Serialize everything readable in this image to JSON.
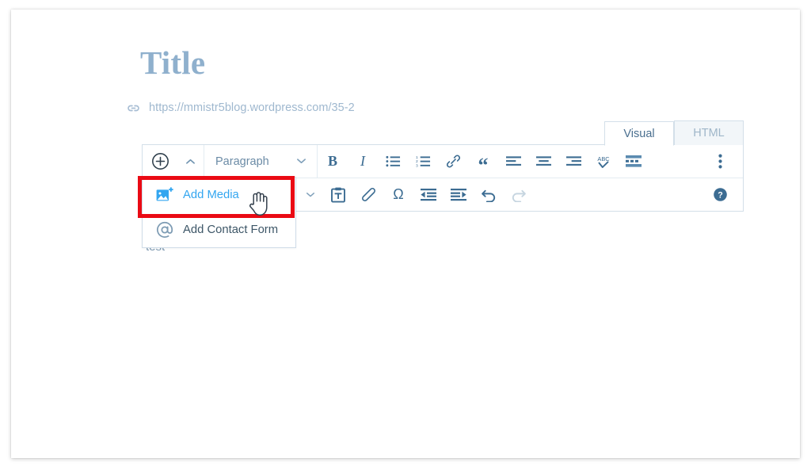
{
  "editor": {
    "title": "Title",
    "permalink": {
      "icon": "link-icon",
      "url": "https://mmistr5blog.wordpress.com/35-2"
    },
    "body_text": "test"
  },
  "mode_tabs": [
    {
      "label": "Visual",
      "active": true
    },
    {
      "label": "HTML",
      "active": false
    }
  ],
  "toolbar": {
    "insert_button_label": "+",
    "collapse_caret_label": "⌃",
    "format_select": {
      "value": "Paragraph",
      "caret": "⌄"
    },
    "row1": [
      {
        "name": "bold-icon",
        "label": "B"
      },
      {
        "name": "italic-icon",
        "label": "I"
      },
      {
        "name": "bulleted-list-icon",
        "label": ""
      },
      {
        "name": "numbered-list-icon",
        "label": ""
      },
      {
        "name": "link-icon",
        "label": ""
      },
      {
        "name": "blockquote-icon",
        "label": "“"
      },
      {
        "name": "align-left-icon",
        "label": ""
      },
      {
        "name": "align-center-icon",
        "label": ""
      },
      {
        "name": "align-right-icon",
        "label": ""
      },
      {
        "name": "spellcheck-icon",
        "label": "ABC"
      },
      {
        "name": "read-more-icon",
        "label": ""
      }
    ],
    "row1_right": {
      "name": "kitchen-sink-icon",
      "label": ""
    },
    "row2": [
      {
        "name": "paste-as-text-icon",
        "label": ""
      },
      {
        "name": "clear-formatting-icon",
        "label": ""
      },
      {
        "name": "special-character-icon",
        "label": "Ω"
      },
      {
        "name": "decrease-indent-icon",
        "label": ""
      },
      {
        "name": "increase-indent-icon",
        "label": ""
      },
      {
        "name": "undo-icon",
        "label": ""
      },
      {
        "name": "redo-icon",
        "label": "",
        "disabled": true
      }
    ],
    "row2_right": {
      "name": "help-icon",
      "label": "?"
    }
  },
  "insert_menu": {
    "items": [
      {
        "label": "Add Media",
        "icon": "add-media-icon",
        "hovered": true
      },
      {
        "label": "Add Contact Form",
        "icon": "at-sign-icon",
        "hovered": false
      }
    ]
  },
  "annotation": {
    "highlight_color": "#ea0a14",
    "target": "Add Media"
  },
  "colors": {
    "title": "#8fb0cd",
    "permalink": "#9fb8cf",
    "toolbar_icon": "#3c6c92",
    "accent_blue": "#33a6f0",
    "border": "#d3dfe9"
  }
}
